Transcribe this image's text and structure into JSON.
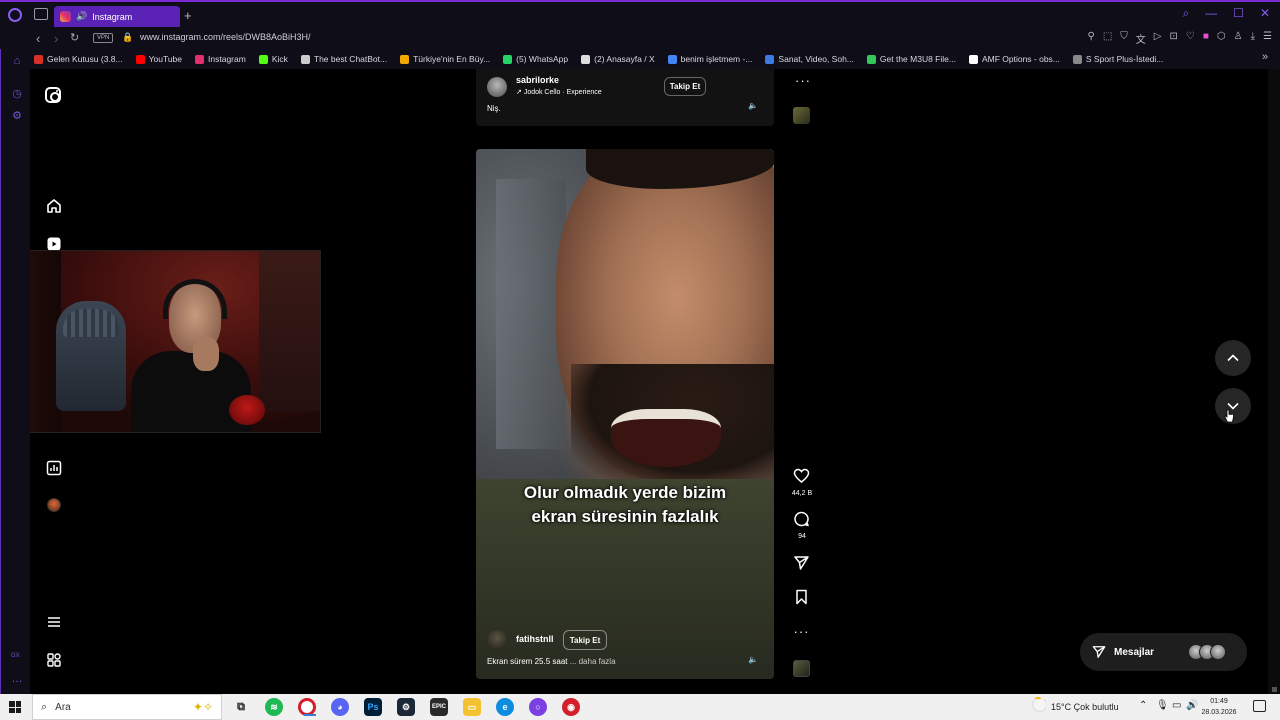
{
  "browser": {
    "tab_title": "Instagram",
    "url": "www.instagram.com/reels/DWB8AoBiH3H/",
    "vpn_label": "VPN",
    "gx_label": "GX",
    "bookmarks": [
      {
        "label": "Gelen Kutusu (3.8...",
        "icon": "gmail-icon",
        "color": "#d93025"
      },
      {
        "label": "YouTube",
        "icon": "youtube-icon",
        "color": "#ff0000"
      },
      {
        "label": "Instagram",
        "icon": "instagram-icon",
        "color": "#e1306c"
      },
      {
        "label": "Kick",
        "icon": "kick-icon",
        "color": "#53fc18"
      },
      {
        "label": "The best ChatBot...",
        "icon": "chatbot-icon",
        "color": "#cccccc"
      },
      {
        "label": "Türkiye'nin En Büy...",
        "icon": "shop-icon",
        "color": "#f2a900"
      },
      {
        "label": "(5) WhatsApp",
        "icon": "whatsapp-icon",
        "color": "#25d366"
      },
      {
        "label": "(2) Anasayfa / X",
        "icon": "x-icon",
        "color": "#dddddd"
      },
      {
        "label": "benim işletmem -...",
        "icon": "google-icon",
        "color": "#4285f4"
      },
      {
        "label": "Sanat, Video, Soh...",
        "icon": "chat-icon",
        "color": "#3d7be0"
      },
      {
        "label": "Get the M3U8 File...",
        "icon": "m3u8-icon",
        "color": "#34c759"
      },
      {
        "label": "AMF Options - obs...",
        "icon": "github-icon",
        "color": "#ffffff"
      },
      {
        "label": "S Sport Plus-İstedi...",
        "icon": "ssport-icon",
        "color": "#888888"
      }
    ]
  },
  "previous_reel": {
    "username": "sabrilorke",
    "audio": "Jodok Cello · Experience",
    "follow_label": "Takip Et",
    "caption": "Niş."
  },
  "reel": {
    "subtitle_line1": "Olur olmadık yerde bizim",
    "subtitle_line2": "ekran süresinin fazlalık",
    "username": "fatihstnll",
    "follow_label": "Takip Et",
    "caption": "Ekran sürem 25.5 saat",
    "caption_more": "... daha fazla",
    "likes": "44,2 B",
    "comments": "94"
  },
  "messages": {
    "label": "Mesajlar"
  },
  "taskbar": {
    "search_placeholder": "Ara",
    "weather": "15°C  Çok bulutlu",
    "time": "01:49",
    "date": "28.03.2026"
  }
}
